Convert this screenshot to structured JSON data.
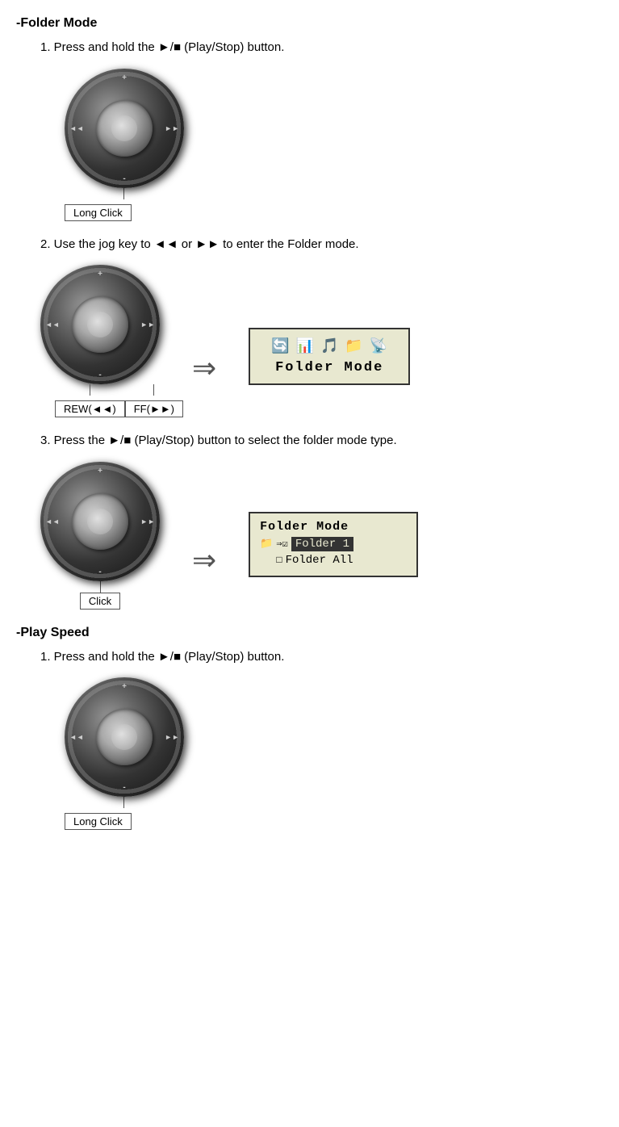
{
  "sections": [
    {
      "id": "folder-mode",
      "header": "-Folder Mode",
      "steps": [
        {
          "id": "step1",
          "text": "1. Press and hold the  ►/■  (Play/Stop) button.",
          "label": "Long Click"
        },
        {
          "id": "step2",
          "text": "2. Use the jog key to  ◄◄  or  ►►  to enter the Folder mode.",
          "label_left": "REW(◄◄)",
          "label_right": "FF(►►)",
          "lcd_title": "Folder Mode",
          "lcd_icons": [
            "🔄",
            "📊",
            "🎵",
            "📁",
            "📡"
          ]
        },
        {
          "id": "step3",
          "text": "3. Press the  ►/■  (Play/Stop) button to select the folder mode type.",
          "label": "Click",
          "lcd_header": "Folder Mode",
          "lcd_item1": "⇒☑ Folder 1",
          "lcd_item2": "   □ Folder All"
        }
      ]
    },
    {
      "id": "play-speed",
      "header": "-Play Speed",
      "steps": [
        {
          "id": "step1",
          "text": "1. Press and hold the  ►/■  (Play/Stop) button.",
          "label": "Long Click"
        }
      ]
    }
  ],
  "arrows": {
    "right": "⇒"
  }
}
